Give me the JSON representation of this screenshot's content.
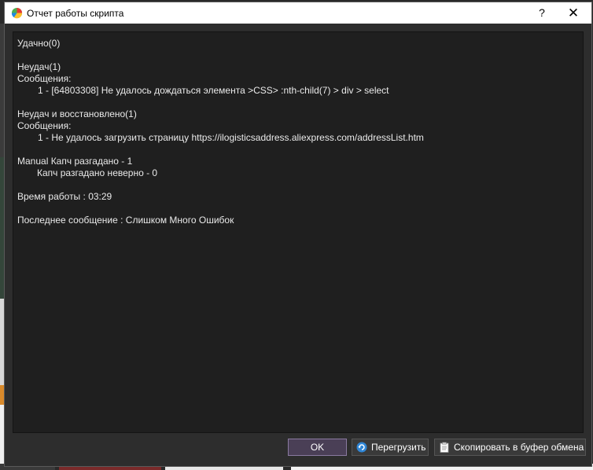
{
  "window": {
    "title": "Отчет работы скрипта",
    "help_label": "?",
    "close_label": "✕"
  },
  "report": {
    "success": "Удачно(0)",
    "failures_header": "Неудач(1)",
    "failures_messages_label": "Сообщения:",
    "failure_message": "1 - [64803308] Не удалось дождаться элемента  >CSS> :nth-child(7) > div > select",
    "recovered_header": "Неудач и восстановлено(1)",
    "recovered_messages_label": "Сообщения:",
    "recovered_message": "1 - Не удалось загрузить страницу https://ilogisticsaddress.aliexpress.com/addressList.htm",
    "captcha_solved": "Manual Капч разгадано - 1",
    "captcha_wrong": "Капч разгадано неверно - 0",
    "run_time": "Время работы : 03:29",
    "last_message": "Последнее сообщение : Слишком Много Ошибок"
  },
  "buttons": {
    "ok_label": "OK",
    "reload_label": "Перегрузить",
    "copy_label": "Скопировать в буфер обмена"
  },
  "icons": {
    "app": "pie-chart-icon",
    "reload": "refresh-icon",
    "copy": "clipboard-icon"
  },
  "colors": {
    "report_background": "#1f1f1f",
    "report_text": "#eaeaea",
    "ok_button_accent": "#4a3f56",
    "titlebar": "#ffffff"
  }
}
